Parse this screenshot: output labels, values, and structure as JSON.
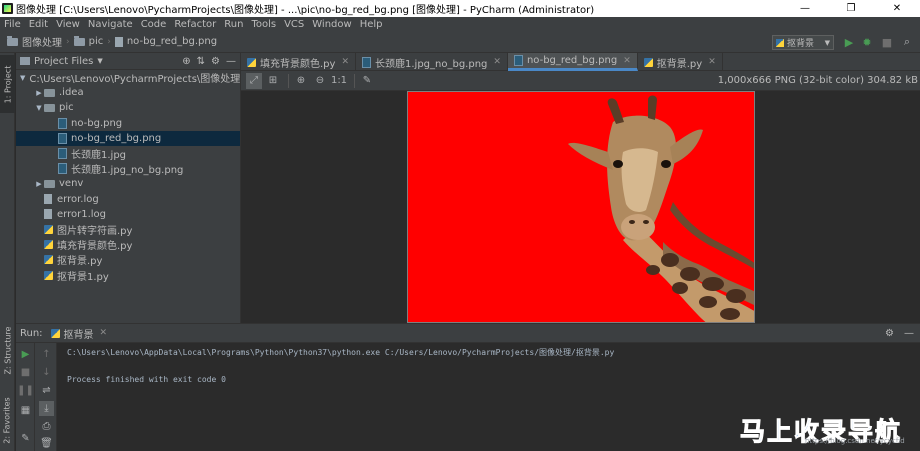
{
  "window": {
    "title": "图像处理 [C:\\Users\\Lenovo\\PycharmProjects\\图像处理] - ...\\pic\\no-bg_red_bg.png [图像处理] - PyCharm (Administrator)",
    "minimize": "—",
    "maximize": "❐",
    "close": "✕"
  },
  "menu": [
    "File",
    "Edit",
    "View",
    "Navigate",
    "Code",
    "Refactor",
    "Run",
    "Tools",
    "VCS",
    "Window",
    "Help"
  ],
  "breadcrumb": {
    "items": [
      "图像处理",
      "pic",
      "no-bg_red_bg.png"
    ],
    "separator": "›"
  },
  "run_config": {
    "label": "抠背景"
  },
  "left_strip": {
    "project_tab": "1: Project",
    "structure_tab": "Z: Structure",
    "favorites_tab": "2: Favorites"
  },
  "project": {
    "header": "Project Files",
    "tree": [
      {
        "label": "C:\\Users\\Lenovo\\PycharmProjects\\图像处理",
        "type": "folder",
        "depth": 0,
        "expanded": true
      },
      {
        "label": ".idea",
        "type": "folder",
        "depth": 1,
        "expanded": false
      },
      {
        "label": "pic",
        "type": "folder",
        "depth": 1,
        "expanded": true
      },
      {
        "label": "no-bg.png",
        "type": "image",
        "depth": 2
      },
      {
        "label": "no-bg_red_bg.png",
        "type": "image",
        "depth": 2,
        "selected": true
      },
      {
        "label": "长颈鹿1.jpg",
        "type": "image",
        "depth": 2
      },
      {
        "label": "长颈鹿1.jpg_no_bg.png",
        "type": "image",
        "depth": 2
      },
      {
        "label": "venv",
        "type": "folder",
        "depth": 1,
        "expanded": false
      },
      {
        "label": "error.log",
        "type": "text",
        "depth": 1
      },
      {
        "label": "error1.log",
        "type": "text",
        "depth": 1
      },
      {
        "label": "图片转字符画.py",
        "type": "python",
        "depth": 1
      },
      {
        "label": "填充背景颜色.py",
        "type": "python",
        "depth": 1
      },
      {
        "label": "抠背景.py",
        "type": "python",
        "depth": 1
      },
      {
        "label": "抠背景1.py",
        "type": "python",
        "depth": 1
      }
    ]
  },
  "editor": {
    "tabs": [
      {
        "label": "填充背景颜色.py",
        "type": "python",
        "active": false
      },
      {
        "label": "长颈鹿1.jpg_no_bg.png",
        "type": "image",
        "active": false
      },
      {
        "label": "no-bg_red_bg.png",
        "type": "image",
        "active": true
      },
      {
        "label": "抠背景.py",
        "type": "python",
        "active": false
      }
    ],
    "image_info": "1,000x666 PNG (32-bit color) 304.82 kB",
    "actual_size_label": "1:1",
    "image_background_color": "#ff0000"
  },
  "run": {
    "label": "Run:",
    "tab": "抠背景",
    "output": [
      "C:\\Users\\Lenovo\\AppData\\Local\\Programs\\Python\\Python37\\python.exe C:/Users/Lenovo/PycharmProjects/图像处理/抠背景.py",
      "",
      "Process finished with exit code 0"
    ]
  },
  "watermark": {
    "logo_text": "马上收录导航",
    "url": "https://blog.csdn.net/ycycfid"
  },
  "colors": {
    "accent": "#4a88c7",
    "run_green": "#499c54",
    "selected_row": "#0d293e"
  }
}
